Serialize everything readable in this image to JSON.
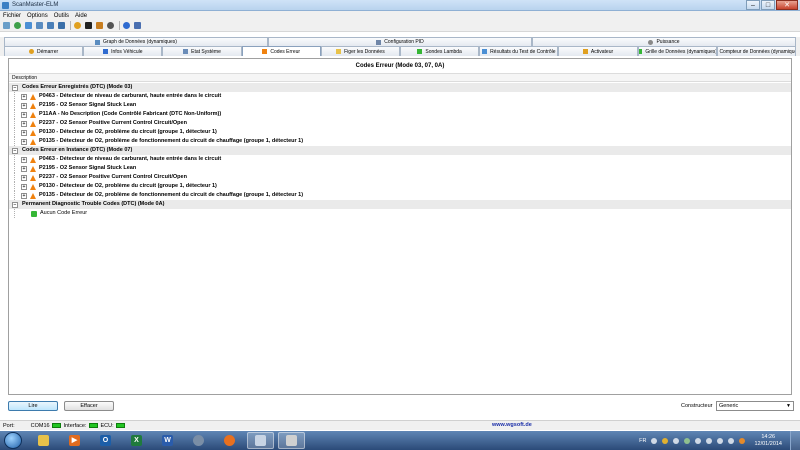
{
  "window": {
    "title": "ScanMaster-ELM"
  },
  "menu": [
    "Fichier",
    "Options",
    "Outils",
    "Aide"
  ],
  "toolbar": [
    "settings-icon",
    "connect-icon",
    "dtc-icon",
    "monitor-icon",
    "graph-icon",
    "data-icon",
    "sensor-icon",
    "help-icon",
    "info-icon",
    "exit-icon"
  ],
  "tabs_top": [
    {
      "label": "Graph de Données (dynamiques)"
    },
    {
      "label": "Configuration PID"
    },
    {
      "label": "Puissance"
    }
  ],
  "tabs_bottom": [
    {
      "label": "Démarrer"
    },
    {
      "label": "Infos Véhicule"
    },
    {
      "label": "Etat Système"
    },
    {
      "label": "Codes Erreur",
      "active": true
    },
    {
      "label": "Figer les Données"
    },
    {
      "label": "Sondes Lambda"
    },
    {
      "label": "Résultats du Test de Contrôle"
    },
    {
      "label": "Activateur"
    },
    {
      "label": "Grille de Données (dynamiques)"
    },
    {
      "label": "Compteur de Données (dynamiques)"
    }
  ],
  "panel": {
    "title": "Codes Erreur (Mode 03, 07, 0A)",
    "column_header": "Description",
    "groups": [
      {
        "title": "Codes Erreur Enregistrés (DTC) (Mode 03)",
        "items": [
          "P0463 - Détecteur de niveau de carburant, haute entrée dans le circuit",
          "P2195 - O2 Sensor Signal Stuck Lean",
          "P11AA - No Description (Code Contrôlé Fabricant (DTC Non-Uniform))",
          "P2237 - O2 Sensor Positive Current Control Circuit/Open",
          "P0130 - Détecteur de O2, problème du circuit (groupe 1, détecteur 1)",
          "P0135 - Détecteur de O2, problème de fonctionnement du circuit de chauffage (groupe 1, détecteur 1)"
        ]
      },
      {
        "title": "Codes Erreur en Instance (DTC) (Mode 07)",
        "items": [
          "P0463 - Détecteur de niveau de carburant, haute entrée dans le circuit",
          "P2195 - O2 Sensor Signal Stuck Lean",
          "P2237 - O2 Sensor Positive Current Control Circuit/Open",
          "P0130 - Détecteur de O2, problème du circuit (groupe 1, détecteur 1)",
          "P0135 - Détecteur de O2, problème de fonctionnement du circuit de chauffage (groupe 1, détecteur 1)"
        ]
      },
      {
        "title": "Permanent Diagnostic Trouble Codes (DTC) (Mode 0A)",
        "items_plain": [
          "Aucun Code Erreur"
        ]
      }
    ]
  },
  "buttons": {
    "read": "Lire",
    "clear": "Effacer"
  },
  "constructor": {
    "label": "Constructeur",
    "value": "Generic"
  },
  "status": {
    "port_label": "Port:",
    "port_value": "COM16",
    "interface_label": "Interface:",
    "ecu_label": "ECU:",
    "link": "www.wgsoft.de"
  },
  "taskbar": {
    "apps": [
      {
        "name": "explorer-icon",
        "glyph": "",
        "color": "#e8c24a"
      },
      {
        "name": "media-player-icon",
        "glyph": "▶",
        "color": "#e06b1f"
      },
      {
        "name": "outlook-icon",
        "glyph": "O",
        "color": "#1c5ea8"
      },
      {
        "name": "excel-icon",
        "glyph": "X",
        "color": "#1f7a3d"
      },
      {
        "name": "word-icon",
        "glyph": "W",
        "color": "#2a5cab"
      },
      {
        "name": "network-icon",
        "glyph": "",
        "color": "#7a8ea6"
      },
      {
        "name": "firefox-icon",
        "glyph": "",
        "color": "#e8701f"
      },
      {
        "name": "scanmaster-icon",
        "glyph": "",
        "color": "#c8d4e4"
      },
      {
        "name": "usb-drive-icon",
        "glyph": "",
        "color": "#d0d0d0"
      }
    ],
    "language": "FR",
    "time": "14:26",
    "date": "12/01/2014"
  },
  "colors": {
    "warning": "#f0820f",
    "ok": "#35b635",
    "link": "#1a2ea8"
  }
}
